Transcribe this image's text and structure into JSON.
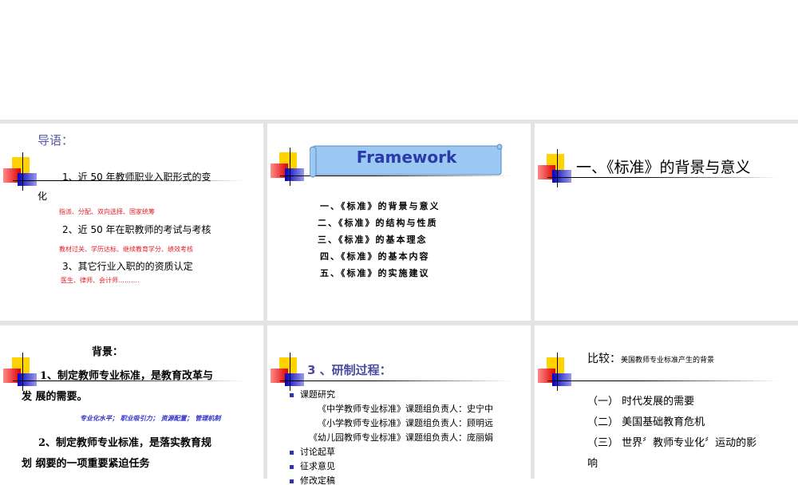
{
  "slides": [
    {
      "title": "导语：",
      "items": [
        {
          "text": "1、近 50 年教师职业入职形式的变",
          "cont": "化",
          "sub": "指派、分配、双向选择、国家统筹"
        },
        {
          "text": "2、近 50 年在职教师的考试与考核",
          "sub": "教材过关、学历达标、继续教育学分、绩效考核"
        },
        {
          "text": "3、其它行业入职的的资质认定",
          "sub": "医生、律师、会计师………."
        }
      ]
    },
    {
      "title": "Framework",
      "items": [
        "一、《标准》的背景与意义",
        "二、《标准》的结构与性质",
        "三、《标准》的基本理念",
        "四、《标准》的基本内容",
        "五、《标准》的实施建议"
      ]
    },
    {
      "title": "一、《标准》的背景与意义"
    },
    {
      "title": "背景：",
      "p1a": "1、制定教师专业标准，是教育改革与",
      "p1b": "发 展的需要。",
      "sub": "专业化水平；  职业吸引力；  资源配置；  管理机制",
      "p2a": "2、制定教师专业标准，是落实教育规",
      "p2b": "划 纲要的一项重要紧迫任务"
    },
    {
      "title": "3 、研制过程：",
      "bullets": [
        "课题研究",
        "讨论起草",
        "征求意见",
        "修改定稿"
      ],
      "leaders": [
        "《中学教师专业标准》课题组负责人：史宁中",
        "《小学教师专业标准》课题组负责人：顾明远",
        "《幼儿园教师专业标准》课题组负责人：庞丽娟"
      ]
    },
    {
      "title": "比较：",
      "subtitle": "美国教师专业标准产生的背景",
      "items": [
        "（一） 时代发展的需要",
        "（二） 美国基础教育危机",
        "（三） 世界〞教师专业化〞运动的影"
      ],
      "cont": "响"
    }
  ],
  "colors": {
    "title_blue": "#5a5aa8",
    "red": "#e0202a",
    "sub_blue": "#3333cc",
    "frame_fill": "#9cc8f4"
  }
}
